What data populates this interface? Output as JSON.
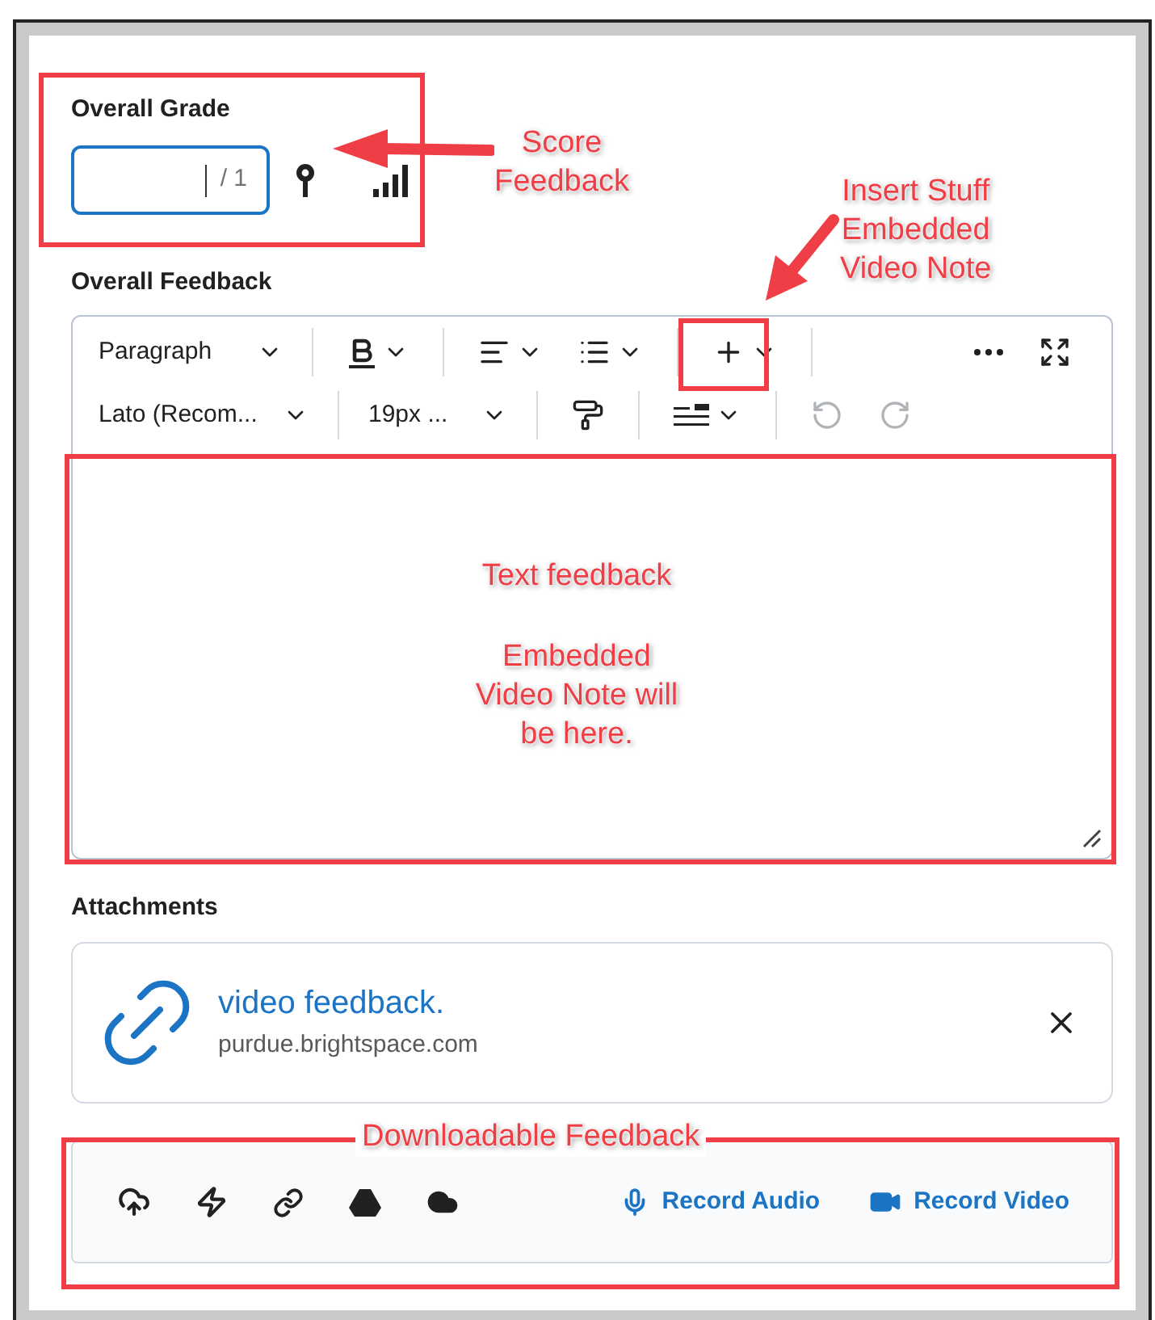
{
  "grade": {
    "label": "Overall Grade",
    "out_of": "/ 1"
  },
  "feedback": {
    "label": "Overall Feedback",
    "paragraph_select": "Paragraph",
    "font_select": "Lato (Recom...",
    "size_select": "19px ...",
    "undo": {
      "disabled": true
    },
    "redo": {
      "disabled": true
    }
  },
  "attachments": {
    "label": "Attachments",
    "items": [
      {
        "title": "video feedback.",
        "source": "purdue.brightspace.com"
      }
    ]
  },
  "record_actions": [
    "Record Audio",
    "Record Video"
  ],
  "annotations": [
    {
      "kind": "callout",
      "lines": [
        "Score",
        "Feedback"
      ]
    },
    {
      "kind": "callout",
      "lines": [
        "Insert Stuff",
        "Embedded",
        "Video Note"
      ]
    },
    {
      "kind": "note",
      "heading": "Text feedback",
      "lines": [
        "Embedded",
        "Video Note will",
        "be here."
      ]
    },
    {
      "kind": "tag",
      "lines": [
        "Downloadable Feedback"
      ]
    }
  ]
}
